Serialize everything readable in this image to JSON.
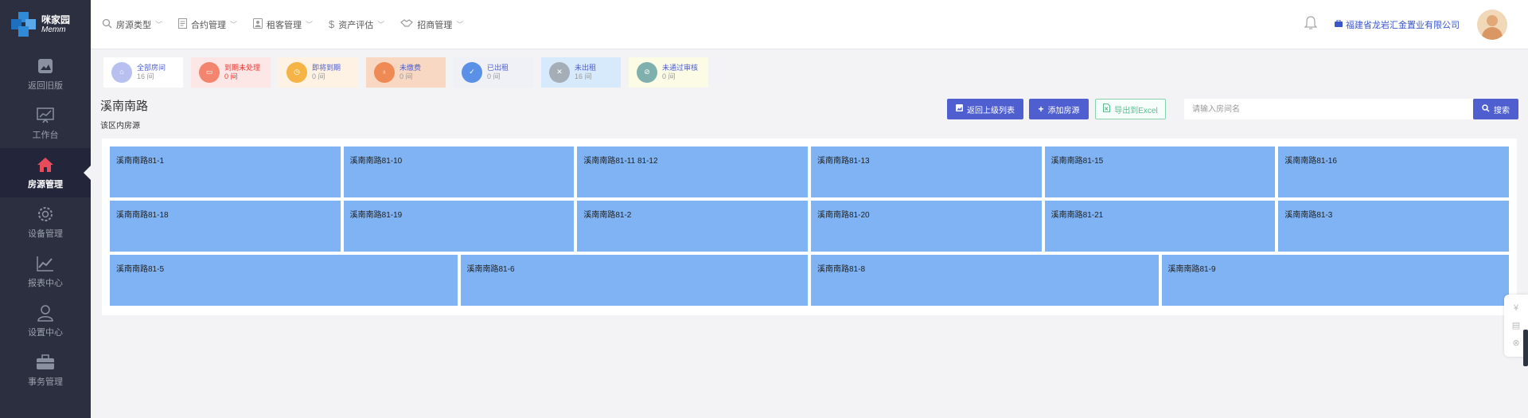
{
  "brand": {
    "name_cn": "咪家园",
    "name_en": "Memm"
  },
  "sidebar": {
    "items": [
      {
        "label": "返回旧版",
        "icon": "image-icon",
        "active": false
      },
      {
        "label": "工作台",
        "icon": "chart-board-icon",
        "active": false
      },
      {
        "label": "房源管理",
        "icon": "home-icon",
        "active": true
      },
      {
        "label": "设备管理",
        "icon": "gear-icon",
        "active": false
      },
      {
        "label": "报表中心",
        "icon": "line-chart-icon",
        "active": false
      },
      {
        "label": "设置中心",
        "icon": "user-icon",
        "active": false
      },
      {
        "label": "事务管理",
        "icon": "briefcase-icon",
        "active": false
      }
    ]
  },
  "topnav": {
    "menu": [
      {
        "label": "房源类型",
        "icon": "search-icon"
      },
      {
        "label": "合约管理",
        "icon": "document-icon"
      },
      {
        "label": "租客管理",
        "icon": "id-card-icon"
      },
      {
        "label": "资产评估",
        "icon": "dollar-icon"
      },
      {
        "label": "招商管理",
        "icon": "handshake-icon"
      }
    ],
    "company": "福建省龙岩汇金置业有限公司"
  },
  "status_cards": [
    {
      "label": "全部房间",
      "count": "16 间",
      "icon": "house-icon",
      "bg": "#ffffff",
      "icon_color": "#b7c0ef",
      "text_color": "#4f5fcf"
    },
    {
      "label": "到期未处理",
      "count": "0 间",
      "icon": "wallet-icon",
      "bg": "#fde7e6",
      "icon_color": "#f3856f",
      "text_color": "#e53935"
    },
    {
      "label": "即将到期",
      "count": "0 间",
      "icon": "calendar-clock-icon",
      "bg": "#fdf2e4",
      "icon_color": "#f5b445",
      "text_color": "#4f5fcf"
    },
    {
      "label": "未缴费",
      "count": "0 间",
      "icon": "money-bag-icon",
      "bg": "#f8d8c2",
      "icon_color": "#f08a55",
      "text_color": "#4f5fcf"
    },
    {
      "label": "已出租",
      "count": "0 间",
      "icon": "house-check-icon",
      "bg": "#f0f1f7",
      "icon_color": "#5a91e6",
      "text_color": "#4f5fcf"
    },
    {
      "label": "未出租",
      "count": "16 间",
      "icon": "house-cross-icon",
      "bg": "#d6eafc",
      "icon_color": "#a5aeb6",
      "text_color": "#4f5fcf"
    },
    {
      "label": "未通过审核",
      "count": "0 间",
      "icon": "ban-icon",
      "bg": "#fbfbe6",
      "icon_color": "#7fb0ae",
      "text_color": "#4f5fcf"
    }
  ],
  "page": {
    "title": "溪南南路",
    "subtitle": "该区内房源"
  },
  "actions": {
    "back_label": "返回上级列表",
    "add_label": "添加房源",
    "export_label": "导出到Excel",
    "search_placeholder": "请输入房间名",
    "search_label": "搜索"
  },
  "rooms": [
    "溪南南路81-1",
    "溪南南路81-10",
    "溪南南路81-11 81-12",
    "溪南南路81-13",
    "溪南南路81-15",
    "溪南南路81-16",
    "溪南南路81-18",
    "溪南南路81-19",
    "溪南南路81-2",
    "溪南南路81-20",
    "溪南南路81-21",
    "溪南南路81-3",
    "溪南南路81-5",
    "溪南南路81-6",
    "溪南南路81-8",
    "溪南南路81-9"
  ],
  "colors": {
    "accent": "#4f5fcf",
    "room_tile": "#7fb3f3",
    "sidebar": "#2c2f3f",
    "company_link": "#3a57c8"
  }
}
